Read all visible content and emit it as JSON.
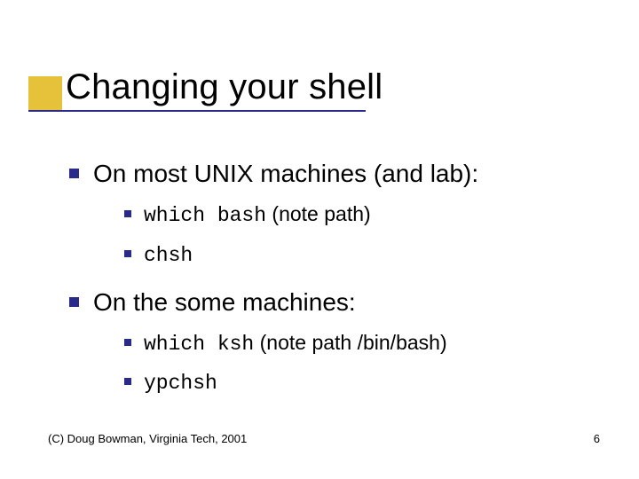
{
  "title": "Changing your shell",
  "bullets": [
    {
      "text": "On most UNIX machines (and lab):",
      "sub": [
        {
          "code": "which bash",
          "note": " (note path)"
        },
        {
          "code": "chsh",
          "note": ""
        }
      ]
    },
    {
      "text": "On the some machines:",
      "sub": [
        {
          "code": "which ksh",
          "note": " (note path /bin/bash)"
        },
        {
          "code": "ypchsh",
          "note": ""
        }
      ]
    }
  ],
  "footer_left": "(C) Doug Bowman, Virginia Tech, 2001",
  "footer_right": "6"
}
